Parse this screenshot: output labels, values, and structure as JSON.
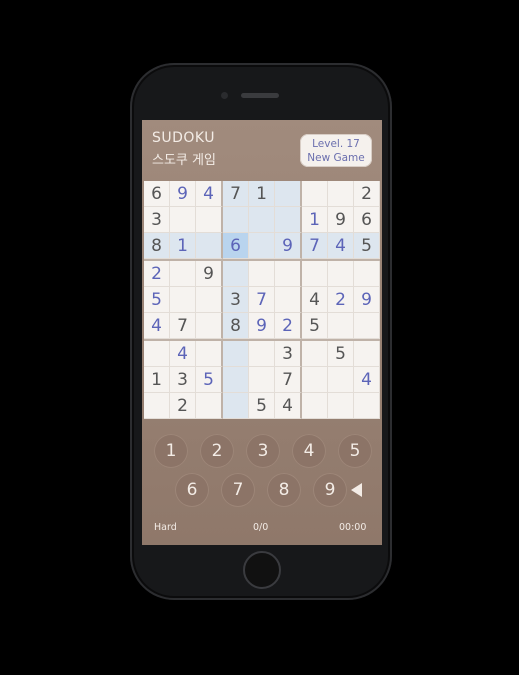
{
  "header": {
    "title_en": "SUDOKU",
    "title_ko": "스도쿠 게임",
    "level_label": "Level. 17",
    "new_game_label": "New Game"
  },
  "board": [
    [
      {
        "v": "6",
        "u": false
      },
      {
        "v": "9",
        "u": true
      },
      {
        "v": "4",
        "u": true
      },
      {
        "v": "7",
        "u": false
      },
      {
        "v": "1",
        "u": false
      },
      {
        "v": "",
        "u": false
      },
      {
        "v": "",
        "u": false
      },
      {
        "v": "",
        "u": false
      },
      {
        "v": "2",
        "u": false
      }
    ],
    [
      {
        "v": "3",
        "u": false
      },
      {
        "v": "",
        "u": false
      },
      {
        "v": "",
        "u": false
      },
      {
        "v": "",
        "u": false
      },
      {
        "v": "",
        "u": false
      },
      {
        "v": "",
        "u": false
      },
      {
        "v": "1",
        "u": true
      },
      {
        "v": "9",
        "u": false
      },
      {
        "v": "6",
        "u": false
      }
    ],
    [
      {
        "v": "8",
        "u": false
      },
      {
        "v": "1",
        "u": true
      },
      {
        "v": "",
        "u": false
      },
      {
        "v": "6",
        "u": true
      },
      {
        "v": "",
        "u": false
      },
      {
        "v": "9",
        "u": true
      },
      {
        "v": "7",
        "u": true
      },
      {
        "v": "4",
        "u": true
      },
      {
        "v": "5",
        "u": false
      }
    ],
    [
      {
        "v": "2",
        "u": true
      },
      {
        "v": "",
        "u": false
      },
      {
        "v": "9",
        "u": false
      },
      {
        "v": "",
        "u": false
      },
      {
        "v": "",
        "u": false
      },
      {
        "v": "",
        "u": false
      },
      {
        "v": "",
        "u": false
      },
      {
        "v": "",
        "u": false
      },
      {
        "v": "",
        "u": false
      }
    ],
    [
      {
        "v": "5",
        "u": true
      },
      {
        "v": "",
        "u": false
      },
      {
        "v": "",
        "u": false
      },
      {
        "v": "3",
        "u": false
      },
      {
        "v": "7",
        "u": true
      },
      {
        "v": "",
        "u": false
      },
      {
        "v": "4",
        "u": false
      },
      {
        "v": "2",
        "u": true
      },
      {
        "v": "9",
        "u": true
      }
    ],
    [
      {
        "v": "4",
        "u": true
      },
      {
        "v": "7",
        "u": false
      },
      {
        "v": "",
        "u": false
      },
      {
        "v": "8",
        "u": false
      },
      {
        "v": "9",
        "u": true
      },
      {
        "v": "2",
        "u": true
      },
      {
        "v": "5",
        "u": false
      },
      {
        "v": "",
        "u": false
      },
      {
        "v": "",
        "u": false
      }
    ],
    [
      {
        "v": "",
        "u": false
      },
      {
        "v": "4",
        "u": true
      },
      {
        "v": "",
        "u": false
      },
      {
        "v": "",
        "u": false
      },
      {
        "v": "",
        "u": false
      },
      {
        "v": "3",
        "u": false
      },
      {
        "v": "",
        "u": false
      },
      {
        "v": "5",
        "u": false
      },
      {
        "v": "",
        "u": false
      }
    ],
    [
      {
        "v": "1",
        "u": false
      },
      {
        "v": "3",
        "u": false
      },
      {
        "v": "5",
        "u": true
      },
      {
        "v": "",
        "u": false
      },
      {
        "v": "",
        "u": false
      },
      {
        "v": "7",
        "u": false
      },
      {
        "v": "",
        "u": false
      },
      {
        "v": "",
        "u": false
      },
      {
        "v": "4",
        "u": true
      }
    ],
    [
      {
        "v": "",
        "u": false
      },
      {
        "v": "2",
        "u": false
      },
      {
        "v": "",
        "u": false
      },
      {
        "v": "",
        "u": false
      },
      {
        "v": "5",
        "u": false
      },
      {
        "v": "4",
        "u": false
      },
      {
        "v": "",
        "u": false
      },
      {
        "v": "",
        "u": false
      },
      {
        "v": "",
        "u": false
      }
    ]
  ],
  "selected": {
    "row": 2,
    "col": 3
  },
  "keypad": [
    "1",
    "2",
    "3",
    "4",
    "5",
    "6",
    "7",
    "8",
    "9"
  ],
  "back_icon": "backspace-triangle-icon",
  "status": {
    "difficulty": "Hard",
    "score": "0/0",
    "timer": "00:00"
  },
  "colors": {
    "user_digit": "#5c64b8",
    "given_digit": "#555555",
    "highlight": "#dde6ef",
    "selected": "#b9d4ee",
    "background": "#9a8475"
  }
}
